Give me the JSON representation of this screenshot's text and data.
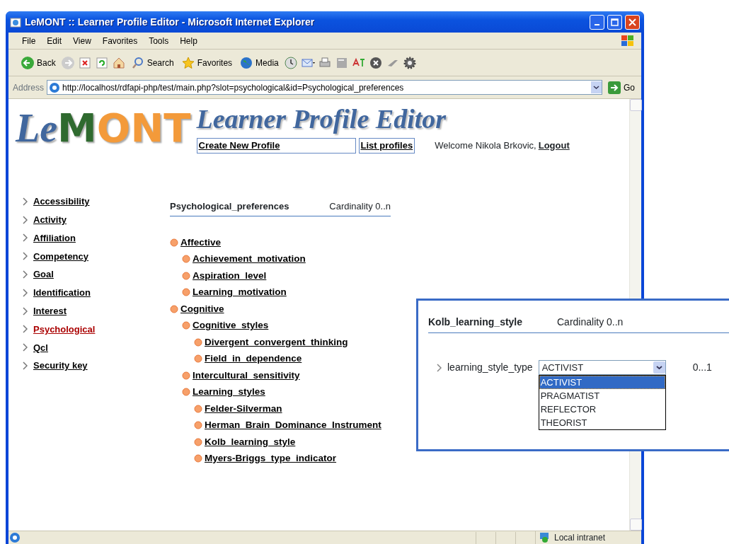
{
  "window": {
    "title": "LeMONT :: Learner Profile Editor - Microsoft Internet Explorer"
  },
  "menu": [
    "File",
    "Edit",
    "View",
    "Favorites",
    "Tools",
    "Help"
  ],
  "toolbar": [
    {
      "kind": "back",
      "label": "Back"
    },
    {
      "kind": "forward"
    },
    {
      "kind": "stop"
    },
    {
      "kind": "refresh"
    },
    {
      "kind": "home"
    },
    {
      "kind": "search",
      "label": "Search"
    },
    {
      "kind": "favorites",
      "label": "Favorites"
    },
    {
      "kind": "media",
      "label": "Media"
    },
    {
      "kind": "history"
    },
    {
      "kind": "mail"
    },
    {
      "kind": "print"
    },
    {
      "kind": "edit"
    },
    {
      "kind": "translate"
    },
    {
      "kind": "messenger"
    },
    {
      "kind": "tool"
    },
    {
      "kind": "gear"
    }
  ],
  "address": {
    "label": "Address",
    "url": "http://localhost/rdfapi-php/test/main.php?slot=psychological&id=Psychological_preferences",
    "go": "Go"
  },
  "header": {
    "logo": "LeMONT",
    "subtitle": "Learner Profile Editor",
    "links": [
      "Create New Profile",
      "List profiles"
    ],
    "welcome": "Welcome Nikola Brkovic,",
    "logout": "Logout"
  },
  "sidebar": {
    "items": [
      {
        "label": "Accessibility",
        "selected": false
      },
      {
        "label": "Activity",
        "selected": false
      },
      {
        "label": "Affiliation",
        "selected": false
      },
      {
        "label": "Competency",
        "selected": false
      },
      {
        "label": "Goal",
        "selected": false
      },
      {
        "label": "Identification",
        "selected": false
      },
      {
        "label": "Interest",
        "selected": false
      },
      {
        "label": "Psychological",
        "selected": true
      },
      {
        "label": "Qcl",
        "selected": false
      },
      {
        "label": "Security key",
        "selected": false
      }
    ]
  },
  "panel": {
    "title": "Psychological_preferences",
    "cardinality": "Cardinality 0..n",
    "tree": [
      {
        "label": "Affective",
        "children": [
          {
            "label": "Achievement_motivation"
          },
          {
            "label": "Aspiration_level"
          },
          {
            "label": "Learning_motivation"
          }
        ]
      },
      {
        "label": "Cognitive",
        "children": [
          {
            "label": "Cognitive_styles",
            "children": [
              {
                "label": "Divergent_convergent_thinking"
              },
              {
                "label": "Field_in_dependence"
              }
            ]
          },
          {
            "label": "Intercultural_sensitivity"
          },
          {
            "label": "Learning_styles",
            "children": [
              {
                "label": "Felder-Silverman"
              },
              {
                "label": "Herman_Brain_Dominance_Instrument"
              },
              {
                "label": "Kolb_learning_style"
              },
              {
                "label": "Myers-Briggs_type_indicator"
              }
            ]
          }
        ]
      }
    ]
  },
  "popup": {
    "title": "Kolb_learning_style",
    "cardinality": "Cardinality 0..n",
    "field": "learning_style_type",
    "value": "ACTIVIST",
    "range": "0...1",
    "options": [
      {
        "label": "ACTIVIST",
        "selected": true
      },
      {
        "label": "PRAGMATIST",
        "selected": false
      },
      {
        "label": "REFLECTOR",
        "selected": false
      },
      {
        "label": "THEORIST",
        "selected": false
      }
    ]
  },
  "status_bar": {
    "zone": "Local intranet"
  }
}
